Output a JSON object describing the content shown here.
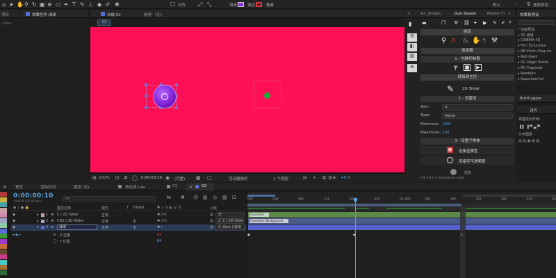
{
  "toolbar": {
    "snap_label": "对齐",
    "fill_label": "填充",
    "stroke_label": "描边",
    "stroke_width": "-像素",
    "default_label": "默认",
    "search_placeholder": "搜索帮助",
    "fill_color": "#8b30d6",
    "stroke_color": "#e03a3a"
  },
  "left_panel": {
    "tab": "项目",
    "sub": "<bwe"
  },
  "effects_panel": {
    "tab": "效果控件 球球"
  },
  "comp_panel": {
    "tab": "合成 02",
    "footage_tab": "素材 （无）",
    "comp_name": "02",
    "bg_color": "#ff0f55",
    "zoom": "100%",
    "timecode": "0:00:00:10",
    "quality": "(完整)",
    "camera": "活动摄像机",
    "views": "1 个视图",
    "exposure": "+0.0"
  },
  "duik": {
    "tabs": [
      "&n_Sliders",
      "Duik Bassel",
      "Motion Ti"
    ],
    "section_bind": "绑定",
    "section_link": "连接器",
    "create_controller": "1 - 创建控制器",
    "link_master": "链接到主控",
    "slider_label": "2D Slider",
    "settings": "1 - 设置值",
    "axis_label": "Axis:",
    "axis_value": "X",
    "type_label": "Type:",
    "type_value": "Value",
    "min_label": "Minimum:",
    "min_value": "-100",
    "max_label": "Maximum:",
    "max_value": "100",
    "select_target": "3 - 设置子物体",
    "connect_prop": "连接至属性",
    "connect_opacity": "连接至不透明度",
    "version": "v16.0.11 | rainboxprod.coop",
    "help": "帮助"
  },
  "effects_presets": {
    "tab": "效果和预设",
    "items": [
      "* 动画预设",
      "▸ 3D 通道",
      "▸ CINEMA 4D",
      "▸ Film Emulation",
      "▸ RE:Vision Plug-ins",
      "▸ Red Giant",
      "▸ RG Magic Bullet",
      "▸ RG Trapcode",
      "▸ Rowbyte",
      "▸ Superluminal"
    ]
  },
  "buttcapper": {
    "tab": "ButtCapper"
  },
  "align": {
    "tab": "对齐",
    "sub": "将图层对齐到:",
    "dist": "分布图层"
  },
  "timeline": {
    "tabs": [
      "预览",
      "渲染队列",
      "图层 (无)",
      "角色导入Ae",
      "01",
      "02"
    ],
    "timecode": "0:00:00:10",
    "timecode_sub": "00010 (25.00 fps)",
    "search_placeholder": "ρ▾",
    "columns": {
      "name": "图层名称",
      "mode": "模式",
      "t": "T",
      "trkmat": "TrkMat",
      "parent": "父级"
    },
    "layers": [
      {
        "num": "1",
        "name": "C | 2D Slider",
        "mode": "正常",
        "trkmat": "",
        "parent": "无",
        "color": "#c7a3a3"
      },
      {
        "num": "2",
        "name": "CBG | 2D Slider",
        "mode": "正常",
        "trkmat": "无",
        "parent": "2. C | 2D Slide",
        "color": "#a3a3c7"
      },
      {
        "num": "4",
        "name": "球球",
        "mode": "正常",
        "trkmat": "无",
        "parent": "4. Zero | 球球",
        "color": "#5a6bd6"
      }
    ],
    "props": [
      {
        "name": "X 位置",
        "value": "44"
      },
      {
        "name": "Y 位置",
        "value": "84"
      }
    ],
    "track_labels": [
      "Controller",
      "Controller Background"
    ],
    "ruler": [
      "00f",
      "04f",
      "08f",
      "12f",
      "16f",
      "20f",
      "01:00f",
      "04f",
      "08f",
      "12f",
      "16f",
      "20f",
      "02:0"
    ],
    "playhead_label": "0"
  },
  "swatches": [
    "#b23b3b",
    "#c9b13b",
    "#46a3a3",
    "#c7a3a3",
    "#d18bb0",
    "#a3a3c7",
    "#8bc9a3",
    "#5a6bd6",
    "#3b9b3b",
    "#9b3bc9",
    "#c96b3b",
    "#6b4a2b",
    "#c93b8b",
    "#46c9c9",
    "#a3732b",
    "#2b6b3b"
  ]
}
